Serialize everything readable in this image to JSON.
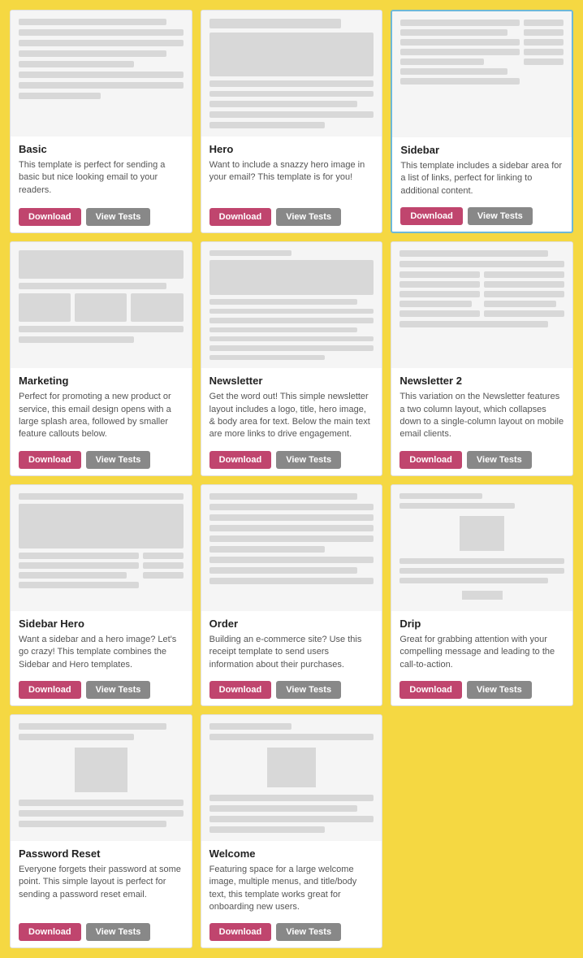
{
  "cards": [
    {
      "id": "basic",
      "title": "Basic",
      "desc": "This template is perfect for sending a basic but nice looking email to your readers.",
      "highlighted": false,
      "download_label": "Download",
      "tests_label": "View Tests",
      "preview": "basic"
    },
    {
      "id": "hero",
      "title": "Hero",
      "desc": "Want to include a snazzy hero image in your email? This template is for you!",
      "highlighted": false,
      "download_label": "Download",
      "tests_label": "View Tests",
      "preview": "hero"
    },
    {
      "id": "sidebar",
      "title": "Sidebar",
      "desc": "This template includes a sidebar area for a list of links, perfect for linking to additional content.",
      "highlighted": true,
      "download_label": "Download",
      "tests_label": "View Tests",
      "preview": "sidebar"
    },
    {
      "id": "marketing",
      "title": "Marketing",
      "desc": "Perfect for promoting a new product or service, this email design opens with a large splash area, followed by smaller feature callouts below.",
      "highlighted": false,
      "download_label": "Download",
      "tests_label": "View Tests",
      "preview": "marketing"
    },
    {
      "id": "newsletter",
      "title": "Newsletter",
      "desc": "Get the word out! This simple newsletter layout includes a logo, title, hero image, & body area for text. Below the main text are more links to drive engagement.",
      "highlighted": false,
      "download_label": "Download",
      "tests_label": "View Tests",
      "preview": "newsletter"
    },
    {
      "id": "newsletter2",
      "title": "Newsletter 2",
      "desc": "This variation on the Newsletter features a two column layout, which collapses down to a single-column layout on mobile email clients.",
      "highlighted": false,
      "download_label": "Download",
      "tests_label": "View Tests",
      "preview": "newsletter2"
    },
    {
      "id": "sidebar-hero",
      "title": "Sidebar Hero",
      "desc": "Want a sidebar and a hero image? Let's go crazy! This template combines the Sidebar and Hero templates.",
      "highlighted": false,
      "download_label": "Download",
      "tests_label": "View Tests",
      "preview": "sidebar-hero"
    },
    {
      "id": "order",
      "title": "Order",
      "desc": "Building an e-commerce site? Use this receipt template to send users information about their purchases.",
      "highlighted": false,
      "download_label": "Download",
      "tests_label": "View Tests",
      "preview": "order"
    },
    {
      "id": "drip",
      "title": "Drip",
      "desc": "Great for grabbing attention with your compelling message and leading to the call-to-action.",
      "highlighted": false,
      "download_label": "Download",
      "tests_label": "View Tests",
      "preview": "drip"
    },
    {
      "id": "password-reset",
      "title": "Password Reset",
      "desc": "Everyone forgets their password at some point. This simple layout is perfect for sending a password reset email.",
      "highlighted": false,
      "download_label": "Download",
      "tests_label": "View Tests",
      "preview": "password"
    },
    {
      "id": "welcome",
      "title": "Welcome",
      "desc": "Featuring space for a large welcome image, multiple menus, and title/body text, this template works great for onboarding new users.",
      "highlighted": false,
      "download_label": "Download",
      "tests_label": "View Tests",
      "preview": "welcome"
    }
  ]
}
